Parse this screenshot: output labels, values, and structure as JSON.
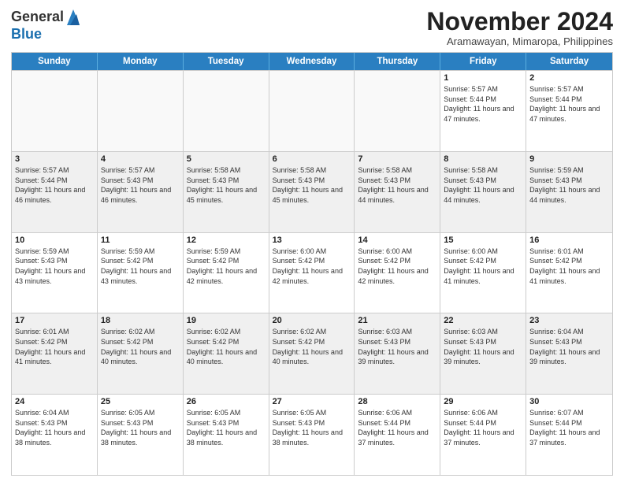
{
  "header": {
    "logo_general": "General",
    "logo_blue": "Blue",
    "month_title": "November 2024",
    "subtitle": "Aramawayan, Mimaropa, Philippines"
  },
  "weekdays": [
    "Sunday",
    "Monday",
    "Tuesday",
    "Wednesday",
    "Thursday",
    "Friday",
    "Saturday"
  ],
  "rows": [
    {
      "cells": [
        {
          "day": "",
          "info": ""
        },
        {
          "day": "",
          "info": ""
        },
        {
          "day": "",
          "info": ""
        },
        {
          "day": "",
          "info": ""
        },
        {
          "day": "",
          "info": ""
        },
        {
          "day": "1",
          "info": "Sunrise: 5:57 AM\nSunset: 5:44 PM\nDaylight: 11 hours and 47 minutes."
        },
        {
          "day": "2",
          "info": "Sunrise: 5:57 AM\nSunset: 5:44 PM\nDaylight: 11 hours and 47 minutes."
        }
      ]
    },
    {
      "cells": [
        {
          "day": "3",
          "info": "Sunrise: 5:57 AM\nSunset: 5:44 PM\nDaylight: 11 hours and 46 minutes."
        },
        {
          "day": "4",
          "info": "Sunrise: 5:57 AM\nSunset: 5:43 PM\nDaylight: 11 hours and 46 minutes."
        },
        {
          "day": "5",
          "info": "Sunrise: 5:58 AM\nSunset: 5:43 PM\nDaylight: 11 hours and 45 minutes."
        },
        {
          "day": "6",
          "info": "Sunrise: 5:58 AM\nSunset: 5:43 PM\nDaylight: 11 hours and 45 minutes."
        },
        {
          "day": "7",
          "info": "Sunrise: 5:58 AM\nSunset: 5:43 PM\nDaylight: 11 hours and 44 minutes."
        },
        {
          "day": "8",
          "info": "Sunrise: 5:58 AM\nSunset: 5:43 PM\nDaylight: 11 hours and 44 minutes."
        },
        {
          "day": "9",
          "info": "Sunrise: 5:59 AM\nSunset: 5:43 PM\nDaylight: 11 hours and 44 minutes."
        }
      ]
    },
    {
      "cells": [
        {
          "day": "10",
          "info": "Sunrise: 5:59 AM\nSunset: 5:43 PM\nDaylight: 11 hours and 43 minutes."
        },
        {
          "day": "11",
          "info": "Sunrise: 5:59 AM\nSunset: 5:42 PM\nDaylight: 11 hours and 43 minutes."
        },
        {
          "day": "12",
          "info": "Sunrise: 5:59 AM\nSunset: 5:42 PM\nDaylight: 11 hours and 42 minutes."
        },
        {
          "day": "13",
          "info": "Sunrise: 6:00 AM\nSunset: 5:42 PM\nDaylight: 11 hours and 42 minutes."
        },
        {
          "day": "14",
          "info": "Sunrise: 6:00 AM\nSunset: 5:42 PM\nDaylight: 11 hours and 42 minutes."
        },
        {
          "day": "15",
          "info": "Sunrise: 6:00 AM\nSunset: 5:42 PM\nDaylight: 11 hours and 41 minutes."
        },
        {
          "day": "16",
          "info": "Sunrise: 6:01 AM\nSunset: 5:42 PM\nDaylight: 11 hours and 41 minutes."
        }
      ]
    },
    {
      "cells": [
        {
          "day": "17",
          "info": "Sunrise: 6:01 AM\nSunset: 5:42 PM\nDaylight: 11 hours and 41 minutes."
        },
        {
          "day": "18",
          "info": "Sunrise: 6:02 AM\nSunset: 5:42 PM\nDaylight: 11 hours and 40 minutes."
        },
        {
          "day": "19",
          "info": "Sunrise: 6:02 AM\nSunset: 5:42 PM\nDaylight: 11 hours and 40 minutes."
        },
        {
          "day": "20",
          "info": "Sunrise: 6:02 AM\nSunset: 5:42 PM\nDaylight: 11 hours and 40 minutes."
        },
        {
          "day": "21",
          "info": "Sunrise: 6:03 AM\nSunset: 5:43 PM\nDaylight: 11 hours and 39 minutes."
        },
        {
          "day": "22",
          "info": "Sunrise: 6:03 AM\nSunset: 5:43 PM\nDaylight: 11 hours and 39 minutes."
        },
        {
          "day": "23",
          "info": "Sunrise: 6:04 AM\nSunset: 5:43 PM\nDaylight: 11 hours and 39 minutes."
        }
      ]
    },
    {
      "cells": [
        {
          "day": "24",
          "info": "Sunrise: 6:04 AM\nSunset: 5:43 PM\nDaylight: 11 hours and 38 minutes."
        },
        {
          "day": "25",
          "info": "Sunrise: 6:05 AM\nSunset: 5:43 PM\nDaylight: 11 hours and 38 minutes."
        },
        {
          "day": "26",
          "info": "Sunrise: 6:05 AM\nSunset: 5:43 PM\nDaylight: 11 hours and 38 minutes."
        },
        {
          "day": "27",
          "info": "Sunrise: 6:05 AM\nSunset: 5:43 PM\nDaylight: 11 hours and 38 minutes."
        },
        {
          "day": "28",
          "info": "Sunrise: 6:06 AM\nSunset: 5:44 PM\nDaylight: 11 hours and 37 minutes."
        },
        {
          "day": "29",
          "info": "Sunrise: 6:06 AM\nSunset: 5:44 PM\nDaylight: 11 hours and 37 minutes."
        },
        {
          "day": "30",
          "info": "Sunrise: 6:07 AM\nSunset: 5:44 PM\nDaylight: 11 hours and 37 minutes."
        }
      ]
    }
  ]
}
